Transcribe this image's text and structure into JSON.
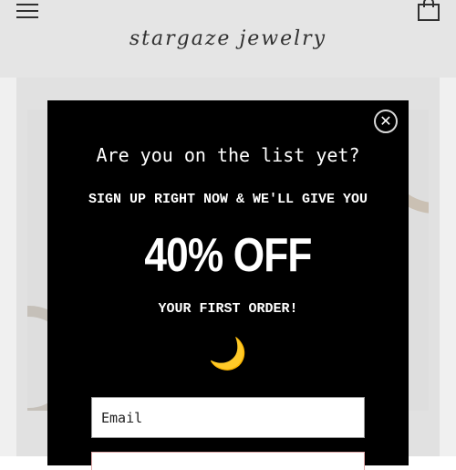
{
  "header": {
    "logo_text": "stargaze jewelry"
  },
  "icons": {
    "menu": "hamburger-menu-icon",
    "cart": "shopping-bag-icon",
    "close": "close-icon",
    "moon": "crescent-moon-icon"
  },
  "popup": {
    "close_symbol": "✕",
    "title": "Are you on the list yet?",
    "subtitle": "SIGN UP RIGHT NOW & WE'LL GIVE YOU",
    "offer": "40% OFF",
    "note": "YOUR FIRST ORDER!",
    "moon_glyph": "🌙",
    "email_placeholder": "Email",
    "email_value": ""
  },
  "colors": {
    "popup_background": "#000000",
    "popup_text": "#ffffff",
    "header_background": "#f4f4f4",
    "moon": "#f1c232"
  }
}
